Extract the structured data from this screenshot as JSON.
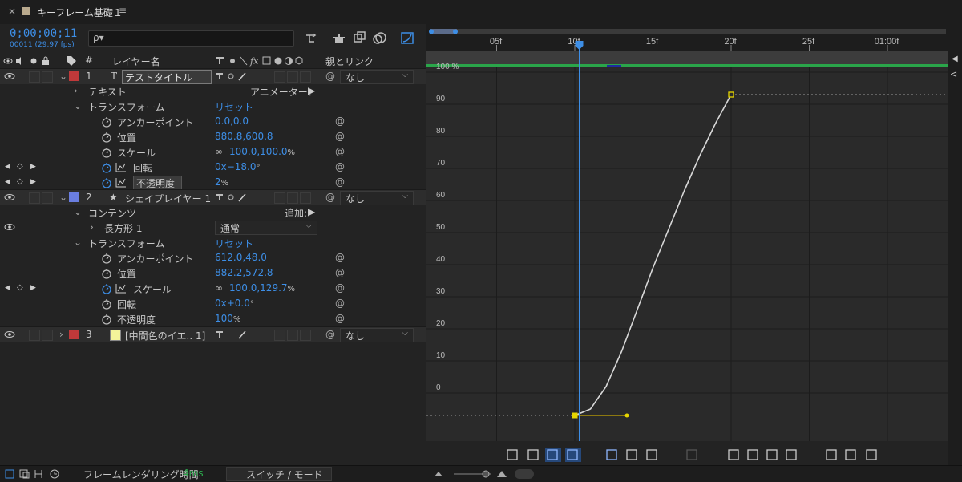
{
  "tab": {
    "title": "キーフレーム基礎１",
    "close": "×",
    "menu": "≡"
  },
  "header": {
    "timecode": "0;00;00;11",
    "fps": "00011 (29.97 fps)",
    "search_placeholder": "ρ▾"
  },
  "columns": {
    "hash": "#",
    "layer_name": "レイヤー名",
    "parent_link": "親とリンク"
  },
  "layers": [
    {
      "num": "1",
      "type_icon": "T",
      "name": "テストタイトル",
      "color": "#c0393a",
      "parent": "なし"
    },
    {
      "num": "2",
      "type_icon": "★",
      "name": "シェイプレイヤー 1",
      "color": "#6a7ee0",
      "parent": "なし"
    },
    {
      "num": "3",
      "type_icon": "",
      "name": "[中間色のイエ.. 1]",
      "color": "#c0393a",
      "parent": "なし",
      "swatch": "#f4f49a"
    }
  ],
  "layer1": {
    "text_group": "テキスト",
    "animator_label": "アニメーター：",
    "transform_group": "トランスフォーム",
    "reset": "リセット",
    "props": [
      {
        "name": "アンカーポイント",
        "value": "0.0,0.0"
      },
      {
        "name": "位置",
        "value": "880.8,600.8"
      },
      {
        "name": "スケール",
        "value": "100.0,100.0",
        "unit": "%"
      },
      {
        "name": "回転",
        "value": "0x−18.0",
        "unit": "°"
      },
      {
        "name": "不透明度",
        "value": "2",
        "unit": "%"
      }
    ]
  },
  "layer2": {
    "contents_group": "コンテンツ",
    "add_label": "追加:",
    "rect_name": "長方形 1",
    "blend_mode": "通常",
    "transform_group": "トランスフォーム",
    "reset": "リセット",
    "props": [
      {
        "name": "アンカーポイント",
        "value": "612.0,48.0"
      },
      {
        "name": "位置",
        "value": "882.2,572.8"
      },
      {
        "name": "スケール",
        "value": "100.0,129.7",
        "unit": "%"
      },
      {
        "name": "回転",
        "value": "0x+0.0",
        "unit": "°"
      },
      {
        "name": "不透明度",
        "value": "100",
        "unit": "%"
      }
    ]
  },
  "ruler": {
    "labels": [
      "05f",
      "10f",
      "15f",
      "20f",
      "25f",
      "01:00f"
    ],
    "frames": [
      5,
      10,
      15,
      20,
      25,
      30
    ]
  },
  "playhead_frame": 11,
  "graph": {
    "y_labels": [
      "100 %",
      "90",
      "80",
      "70",
      "60",
      "50",
      "40",
      "30",
      "20",
      "10",
      "0"
    ],
    "y_values": [
      100,
      90,
      80,
      70,
      60,
      50,
      40,
      30,
      20,
      10,
      0
    ]
  },
  "chart_data": {
    "type": "line",
    "x_unit": "frames",
    "y_unit": "%",
    "ylim": [
      0,
      100
    ],
    "series": [
      {
        "x": [
          10,
          11,
          12,
          13,
          14,
          15,
          16,
          17,
          18,
          19,
          20
        ],
        "values": [
          0,
          2,
          9,
          20,
          33,
          46,
          58,
          70,
          81,
          91,
          100
        ]
      }
    ],
    "keyframes": [
      {
        "frame": 10,
        "value": 0
      },
      {
        "frame": 20,
        "value": 100
      }
    ]
  },
  "status": {
    "render_label": "フレームレンダリング時間",
    "render_time": "4ms",
    "switch_mode": "スイッチ / モード"
  },
  "colors": {
    "accent": "#3d8ee6",
    "work_area": "#2aa54a",
    "keyframe": "#e6d600",
    "curve": "#d8d8d8"
  }
}
